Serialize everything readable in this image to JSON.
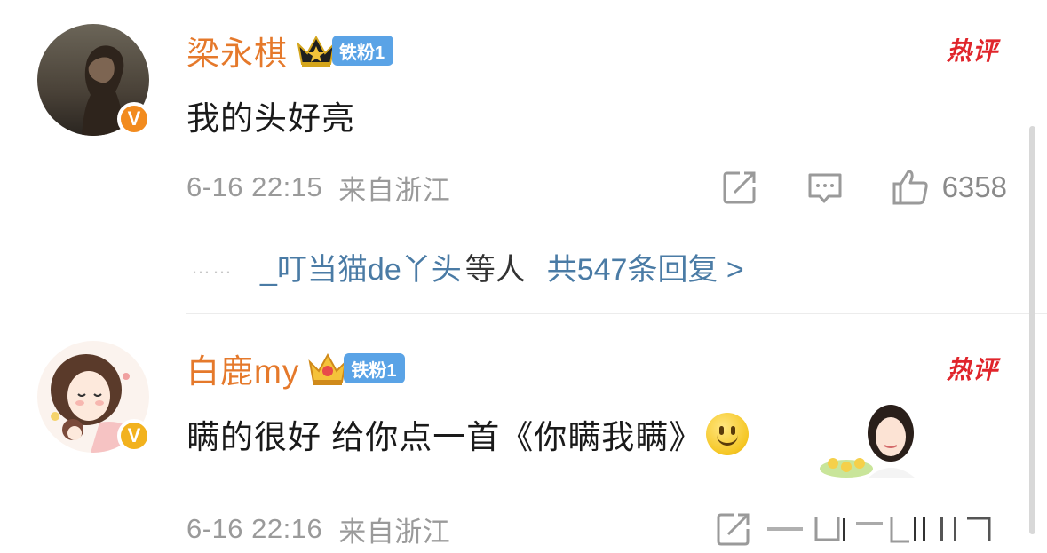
{
  "comments": [
    {
      "username": "梁永棋",
      "fan_badge": "铁粉1",
      "hot_tag": "热评",
      "verified_badge": "V",
      "text": "我的头好亮",
      "time": "6-16 22:15",
      "location": "来自浙江",
      "likes": "6358",
      "replies": {
        "dots": "……",
        "replier": "_叮当猫de丫头",
        "suffix": "等人",
        "summary": "共547条回复 >"
      }
    },
    {
      "username": "白鹿my",
      "fan_badge": "铁粉1",
      "hot_tag": "热评",
      "verified_badge": "V",
      "text": "瞒的很好 给你点一首《你瞒我瞒》",
      "time": "6-16 22:16",
      "location": "来自浙江"
    }
  ],
  "icons": [
    "repost-icon",
    "comment-icon",
    "like-icon",
    "smile-emoji-icon",
    "crown-icon"
  ],
  "colors": {
    "username": "#e5792b",
    "fan_badge": "#5aa3e6",
    "hot_tag": "#e0252b",
    "reply_link": "#4a7ba5",
    "meta": "#9a9a9a"
  }
}
